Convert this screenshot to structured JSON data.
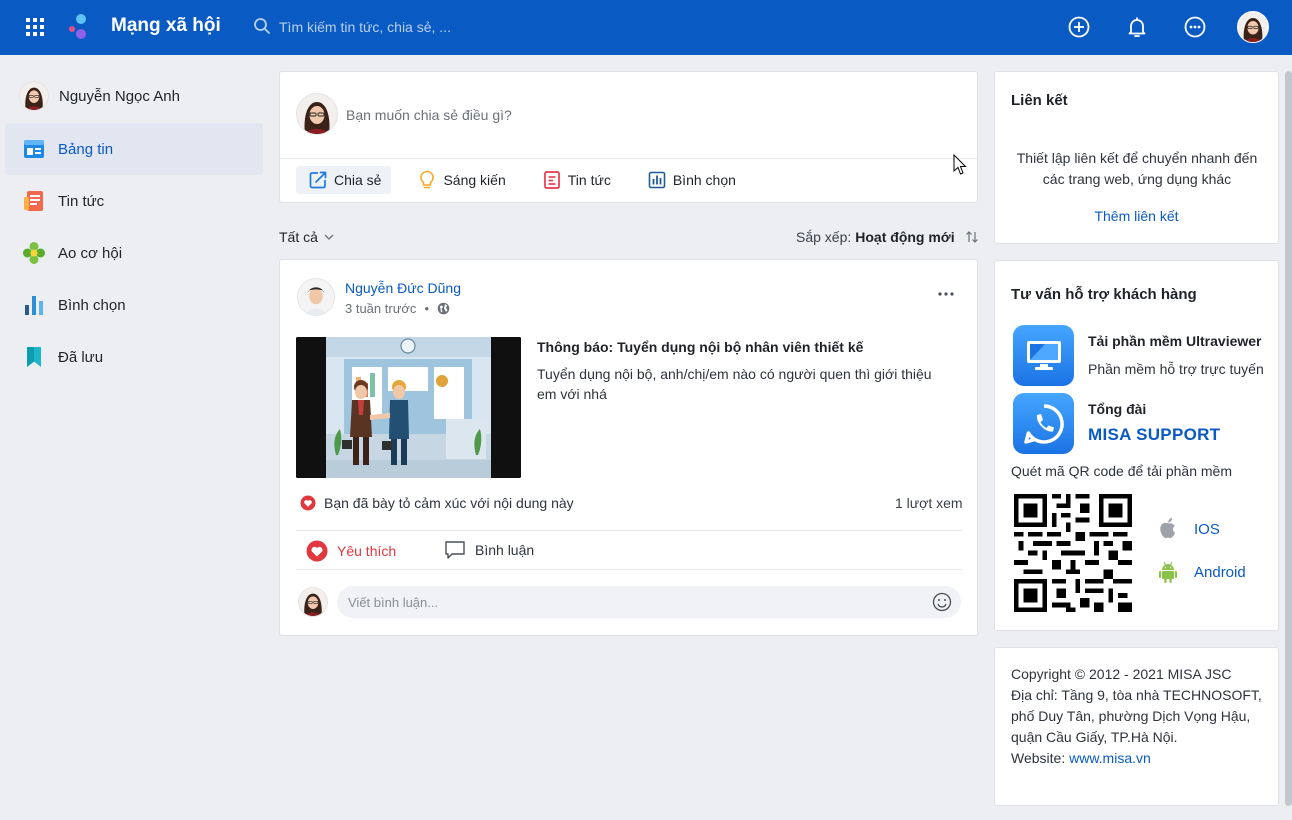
{
  "app": {
    "title": "Mạng xã hội"
  },
  "search": {
    "placeholder": "Tìm kiếm tin tức, chia sẻ, ..."
  },
  "user": {
    "name": "Nguyễn Ngọc Anh"
  },
  "sidebar": {
    "items": [
      {
        "label": "Bảng tin",
        "icon": "newsfeed-icon",
        "active": true
      },
      {
        "label": "Tin tức",
        "icon": "news-icon"
      },
      {
        "label": "Ao cơ hội",
        "icon": "opportunity-icon"
      },
      {
        "label": "Bình chọn",
        "icon": "poll-icon"
      },
      {
        "label": "Đã lưu",
        "icon": "bookmark-icon"
      }
    ]
  },
  "composer": {
    "prompt": "Bạn muốn chia sẻ điều gì?",
    "actions": [
      {
        "label": "Chia sẻ",
        "icon": "share-icon",
        "active": true
      },
      {
        "label": "Sáng kiến",
        "icon": "lightbulb-icon"
      },
      {
        "label": "Tin tức",
        "icon": "news-icon"
      },
      {
        "label": "Bình chọn",
        "icon": "poll-icon"
      }
    ]
  },
  "feed": {
    "filter": "Tất cả",
    "sort_label": "Sắp xếp:",
    "sort_value": "Hoạt động mới"
  },
  "post": {
    "author": "Nguyễn Đức Dũng",
    "time": "3 tuần trước",
    "title": "Thông báo: Tuyển dụng nội bộ nhân viên thiết kế",
    "description": "Tuyển dụng nội bộ, anh/chị/em nào có người quen thì giới thiệu em với nhá",
    "reaction_text": "Bạn đã bày tỏ cảm xúc với nội dung này",
    "views": "1 lượt xem",
    "like_label": "Yêu thích",
    "comment_label": "Bình luận",
    "comment_placeholder": "Viết bình luận..."
  },
  "links": {
    "title": "Liên kết",
    "description": "Thiết lập liên kết để chuyển nhanh đến các trang web, ứng dụng khác",
    "add_label": "Thêm liên kết"
  },
  "support": {
    "title": "Tư vấn hỗ trợ khách hàng",
    "ultraviewer_title": "Tải phần mềm Ultraviewer",
    "ultraviewer_desc": "Phần mềm hỗ trợ trực tuyến",
    "hotline_title": "Tổng đài",
    "hotline_name": "MISA SUPPORT",
    "qr_caption": "Quét mã QR code để tải phần mềm",
    "ios_label": "IOS",
    "android_label": "Android"
  },
  "footer": {
    "copyright": "Copyright © 2012 - 2021 MISA JSC",
    "address_1": "Địa chỉ: Tầng 9, tòa nhà TECHNOSOFT,",
    "address_2": "phố Duy Tân, phường Dịch Vọng Hậu,",
    "address_3": "quận Cầu Giấy, TP.Hà Nội.",
    "website_label": "Website:",
    "website_url": "www.misa.vn"
  },
  "colors": {
    "primary": "#0a5ac4",
    "like": "#e0383e",
    "background": "#edeef2"
  }
}
